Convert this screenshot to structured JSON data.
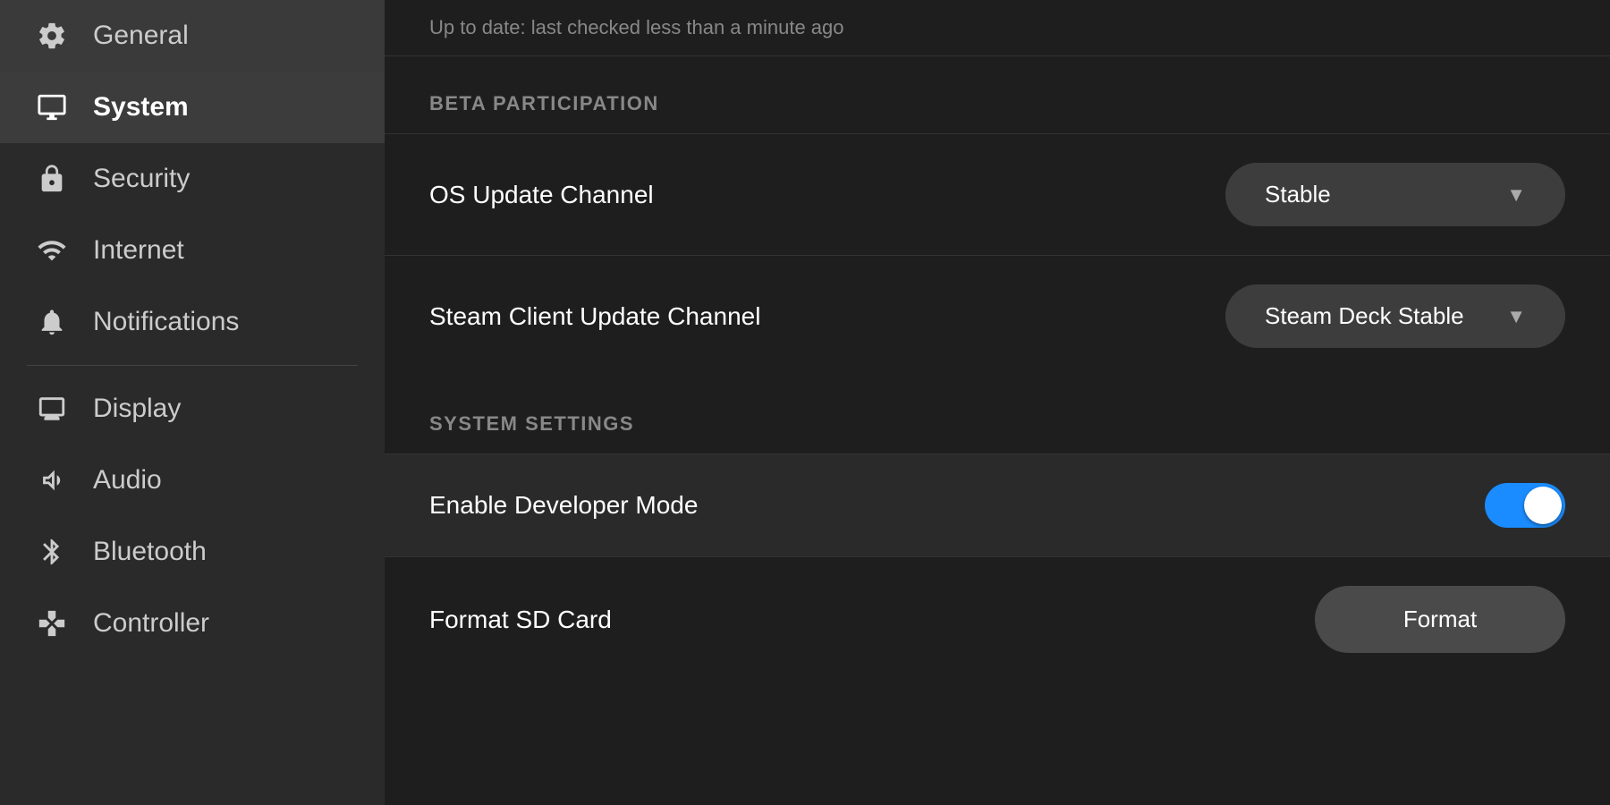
{
  "sidebar": {
    "items": [
      {
        "id": "general",
        "label": "General",
        "icon": "gear",
        "active": false
      },
      {
        "id": "system",
        "label": "System",
        "icon": "monitor",
        "active": true
      },
      {
        "id": "security",
        "label": "Security",
        "icon": "lock",
        "active": false
      },
      {
        "id": "internet",
        "label": "Internet",
        "icon": "wifi",
        "active": false
      },
      {
        "id": "notifications",
        "label": "Notifications",
        "icon": "bell",
        "active": false
      },
      {
        "id": "display",
        "label": "Display",
        "icon": "display",
        "active": false
      },
      {
        "id": "audio",
        "label": "Audio",
        "icon": "speaker",
        "active": false
      },
      {
        "id": "bluetooth",
        "label": "Bluetooth",
        "icon": "bluetooth",
        "active": false
      },
      {
        "id": "controller",
        "label": "Controller",
        "icon": "gamepad",
        "active": false
      }
    ]
  },
  "main": {
    "status_text": "Up to date: last checked less than a minute ago",
    "beta_section_header": "BETA PARTICIPATION",
    "os_update_channel_label": "OS Update Channel",
    "os_update_channel_value": "Stable",
    "steam_client_update_channel_label": "Steam Client Update Channel",
    "steam_client_update_channel_value": "Steam Deck Stable",
    "system_settings_header": "SYSTEM SETTINGS",
    "developer_mode_label": "Enable Developer Mode",
    "developer_mode_enabled": true,
    "format_sd_card_label": "Format SD Card",
    "format_button_label": "Format",
    "chevron_symbol": "▼"
  }
}
